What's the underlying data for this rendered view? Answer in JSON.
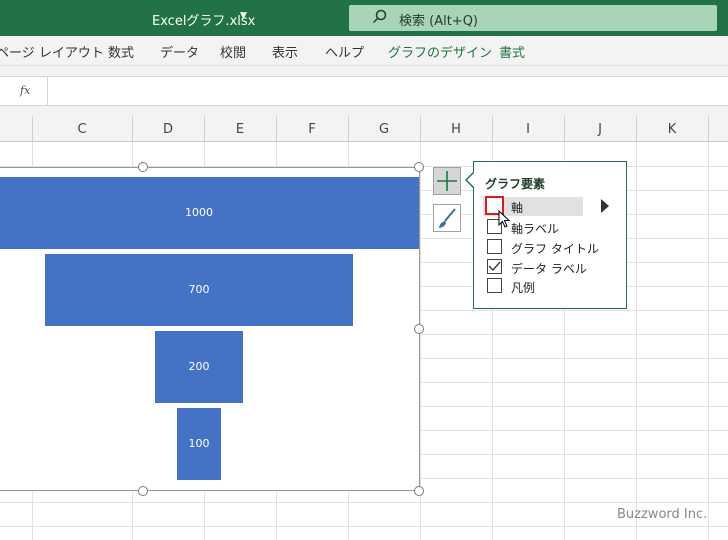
{
  "titlebar": {
    "undo_icon": "undo-icon",
    "customize_icon": "customize-quick-access-icon",
    "doc_title": "Excelグラフ.xlsx",
    "search_placeholder": "検索 (Alt+Q)"
  },
  "ribbon": {
    "tabs": [
      "ページ レイアウト",
      "数式",
      "データ",
      "校閲",
      "表示",
      "ヘルプ",
      "グラフのデザイン",
      "書式"
    ]
  },
  "formula_bar": {
    "fx_label": "fx"
  },
  "columns": [
    "C",
    "D",
    "E",
    "F",
    "G",
    "H",
    "I",
    "J",
    "K"
  ],
  "chart_data": {
    "type": "bar",
    "subtype": "funnel",
    "values": [
      1000,
      700,
      200,
      100
    ],
    "data_labels": [
      "1000",
      "700",
      "200",
      "100"
    ],
    "bar_color": "#4472c4",
    "axis_max": 1000
  },
  "chart_elements": {
    "title": "グラフ要素",
    "items": [
      {
        "label": "軸",
        "checked": false,
        "focused": true,
        "has_submenu": true
      },
      {
        "label": "軸ラベル",
        "checked": false
      },
      {
        "label": "グラフ タイトル",
        "checked": false
      },
      {
        "label": "データ ラベル",
        "checked": true
      },
      {
        "label": "凡例",
        "checked": false
      }
    ]
  },
  "colors": {
    "accent": "#217346",
    "focus": "#d91c1c"
  },
  "watermark": "Buzzword Inc."
}
